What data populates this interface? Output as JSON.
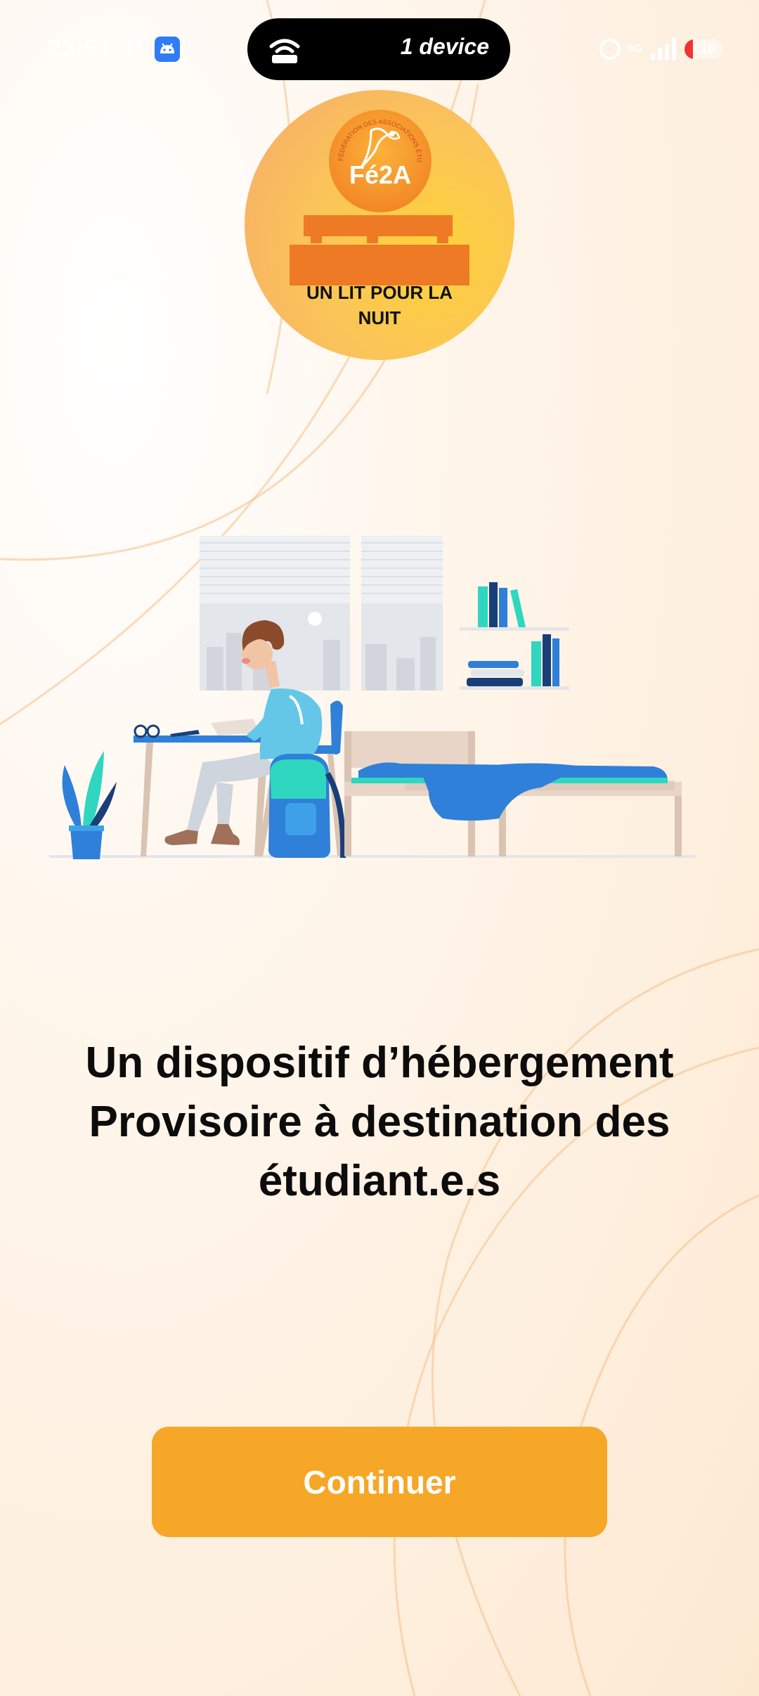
{
  "status_bar": {
    "time": "23:51",
    "notification_letter": "P",
    "pill_text": "1 device",
    "network_label": "5G",
    "battery_level": "16"
  },
  "logo": {
    "brand": "Fé2A",
    "tagline": "UN LIT POUR LA NUIT",
    "ring_text": "FÉDÉRATION DES ASSOCIATIONS ÉTUDIANTES DE L'ARDÈCHE"
  },
  "headline": "Un dispositif d’hébergement Provisoire à destination des étudiant.e.s",
  "continue_button": "Continuer",
  "colors": {
    "accent": "#f6a727",
    "logo_orange": "#f07a1e",
    "logo_yellow": "#fdd23a",
    "illustration_blue": "#2f80d8",
    "illustration_teal": "#2fd6c0",
    "text": "#0c0c0c"
  },
  "icons": {
    "status_android": "android-icon",
    "pill": "wifi-hotspot-icon",
    "alarm": "alarm-icon",
    "signal": "signal-icon",
    "battery": "battery-icon"
  }
}
